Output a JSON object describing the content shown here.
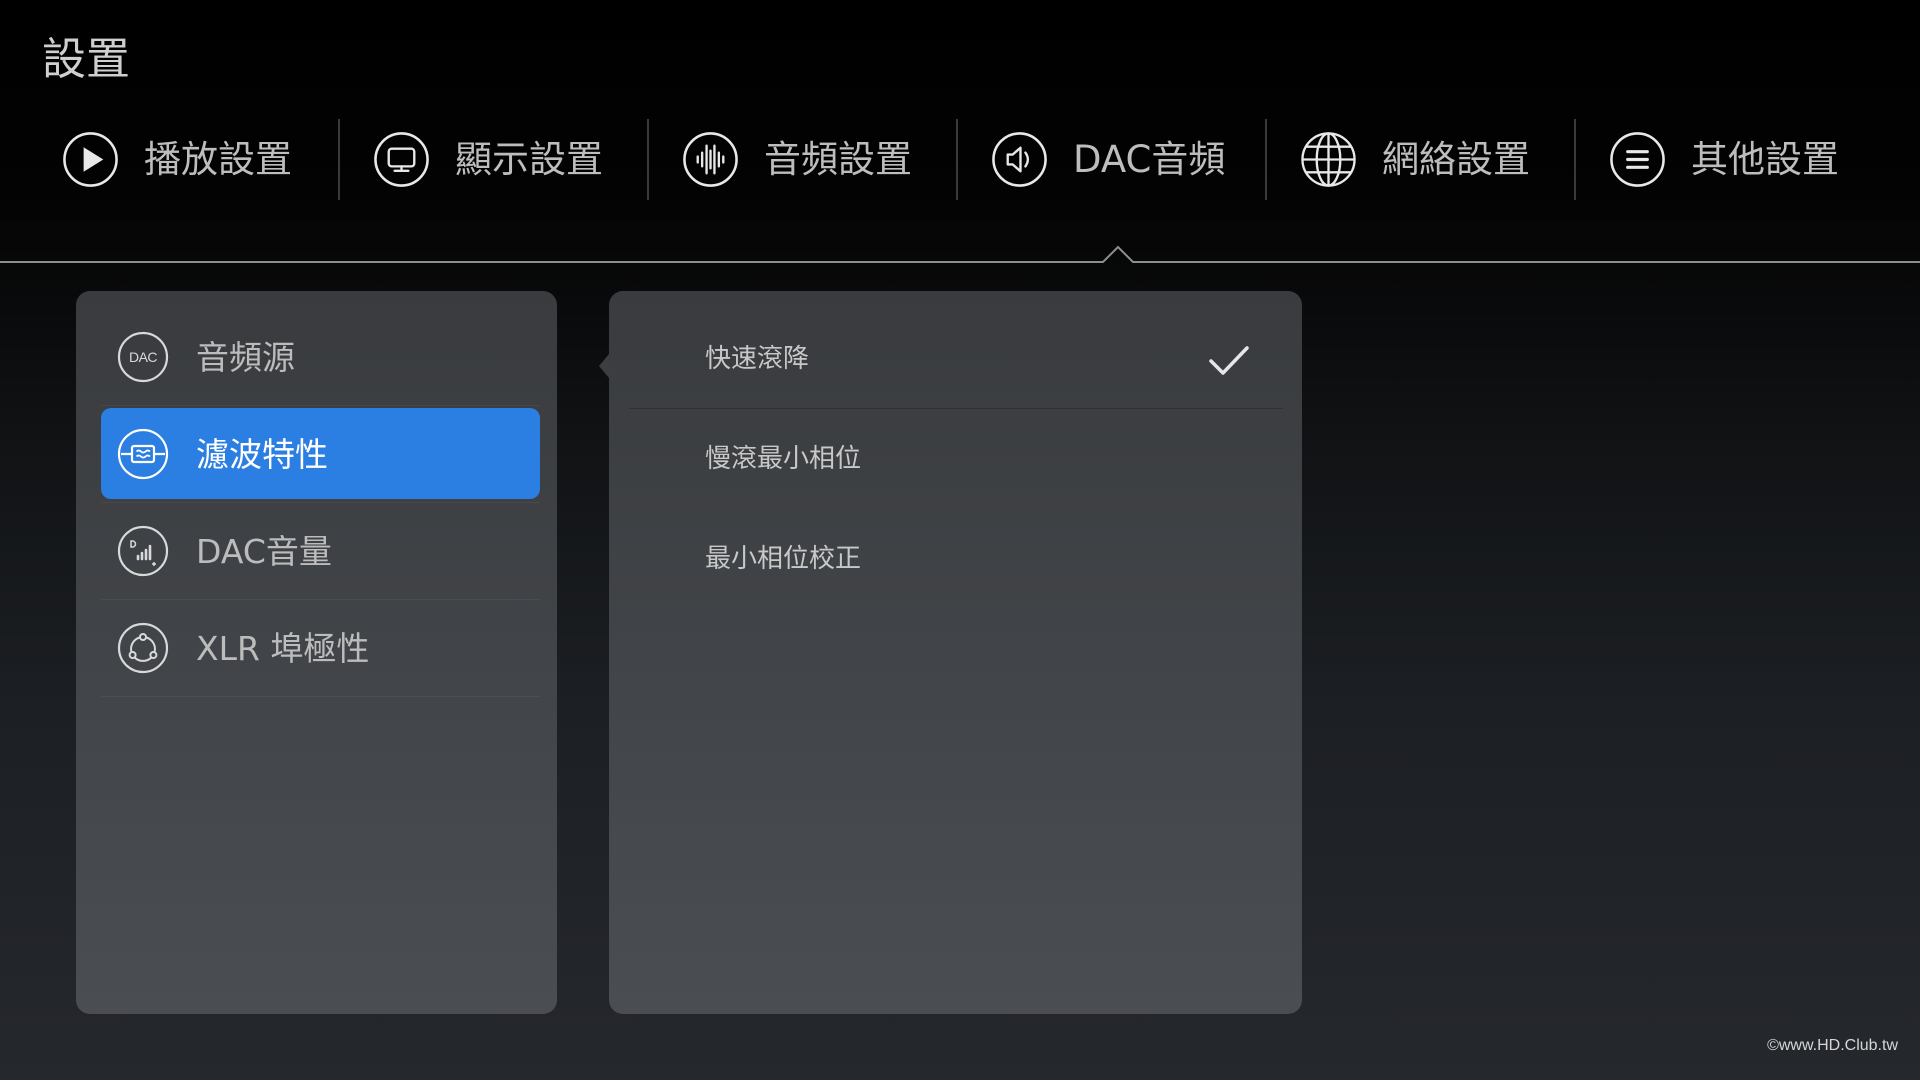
{
  "page": {
    "title": "設置"
  },
  "tabs": [
    {
      "label": "播放設置",
      "icon": "play-icon",
      "active": false
    },
    {
      "label": "顯示設置",
      "icon": "monitor-icon",
      "active": false
    },
    {
      "label": "音頻設置",
      "icon": "audio-waveform-icon",
      "active": false
    },
    {
      "label": "DAC音頻",
      "icon": "speaker-icon",
      "active": true
    },
    {
      "label": "網絡設置",
      "icon": "globe-icon",
      "active": false
    },
    {
      "label": "其他設置",
      "icon": "menu-icon",
      "active": false
    }
  ],
  "menu": {
    "items": [
      {
        "label": "音頻源",
        "icon": "dac-icon",
        "icon_text": "DAC",
        "selected": false
      },
      {
        "label": "濾波特性",
        "icon": "filter-icon",
        "selected": true
      },
      {
        "label": "DAC音量",
        "icon": "volume-bars-icon",
        "selected": false
      },
      {
        "label": "XLR 埠極性",
        "icon": "polarity-icon",
        "selected": false
      }
    ]
  },
  "options": {
    "items": [
      {
        "label": "快速滾降",
        "checked": true
      },
      {
        "label": "慢滾最小相位",
        "checked": false
      },
      {
        "label": "最小相位校正",
        "checked": false
      }
    ]
  },
  "watermark": "©www.HD.Club.tw",
  "colors": {
    "accent": "#2b7ee2",
    "background_top": "#000000",
    "background_bottom": "#25282d",
    "panel": "#414448",
    "text": "#bdbdbd",
    "icon": "#e8e8e8"
  }
}
